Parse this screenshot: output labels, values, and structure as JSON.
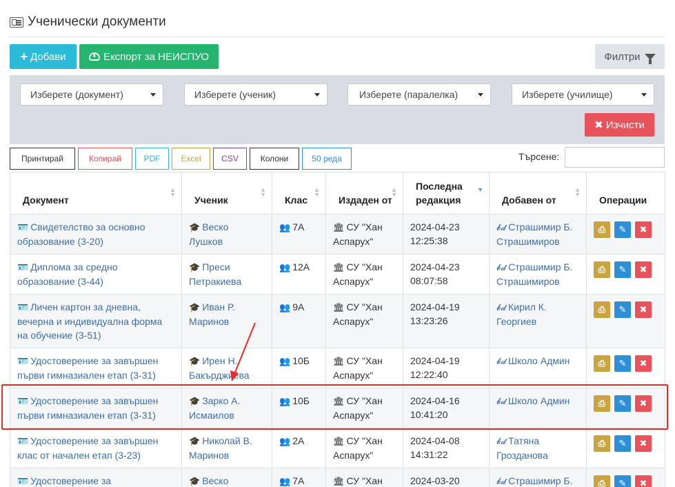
{
  "header": {
    "title": "Ученически документи"
  },
  "toolbar": {
    "add_label": "Добави",
    "export_label": "Експорт за НЕИСПУО",
    "filters_label": "Филтри"
  },
  "filters": {
    "document": "Изберете (документ)",
    "student": "Изберете (ученик)",
    "class": "Изберете (паралелка)",
    "school": "Изберете (училище)",
    "clear_label": "Изчисти"
  },
  "table_tools": [
    "Принтирай",
    "Копирай",
    "PDF",
    "Excel",
    "CSV",
    "Колони",
    "50 реда"
  ],
  "search": {
    "label": "Търсене:",
    "value": ""
  },
  "columns": [
    "Документ",
    "Ученик",
    "Клас",
    "Издаден от",
    "Последна редакция",
    "Добавен от",
    "Операции"
  ],
  "rows": [
    {
      "document": "Свидетелство за основно образование (3-20)",
      "student": "Веско Лушков",
      "class": "7А",
      "issuer": "СУ \"Хан Аспарух\"",
      "edited": "2024-04-23 12:25:38",
      "added_by": "Страшимир Б. Страшимиров"
    },
    {
      "document": "Диплома за средно образование (3-44)",
      "student": "Преси Петракиева",
      "class": "12А",
      "issuer": "СУ \"Хан Аспарух\"",
      "edited": "2024-04-23 08:07:58",
      "added_by": "Страшимир Б. Страшимиров"
    },
    {
      "document": "Личен картон за дневна, вечерна и индивидуална форма на обучение (3-51)",
      "student": "Иван Р. Маринов",
      "class": "9А",
      "issuer": "СУ \"Хан Аспарух\"",
      "edited": "2024-04-19 13:23:26",
      "added_by": "Кирил К. Георгиев"
    },
    {
      "document": "Удостоверение за завършен първи гимназиален етап (3-31)",
      "student": "Ирен Н. Бакърджиева",
      "class": "10Б",
      "issuer": "СУ \"Хан Аспарух\"",
      "edited": "2024-04-19 12:22:40",
      "added_by": "Школо Админ"
    },
    {
      "document": "Удостоверение за завършен първи гимназиален етап (3-31)",
      "student": "Зарко А. Исмаилов",
      "class": "10Б",
      "issuer": "СУ \"Хан Аспарух\"",
      "edited": "2024-04-16 10:41:20",
      "added_by": "Школо Админ"
    },
    {
      "document": "Удостоверение за завършен клас от начален етап (3-23)",
      "student": "Николай В. Маринов",
      "class": "2А",
      "issuer": "СУ \"Хан Аспарух\"",
      "edited": "2024-04-08 14:31:22",
      "added_by": "Татяна Грозданова"
    },
    {
      "document": "Удостоверение за",
      "student": "Веско",
      "class": "7А",
      "issuer": "СУ \"Хан",
      "edited": "2024-03-20",
      "added_by": "Страшимир Б."
    }
  ],
  "colors": {
    "info": "#2bbbd8",
    "success": "#26b56f",
    "danger": "#e8525a",
    "link": "#3e6fa8",
    "highlight": "#e82a2a"
  }
}
